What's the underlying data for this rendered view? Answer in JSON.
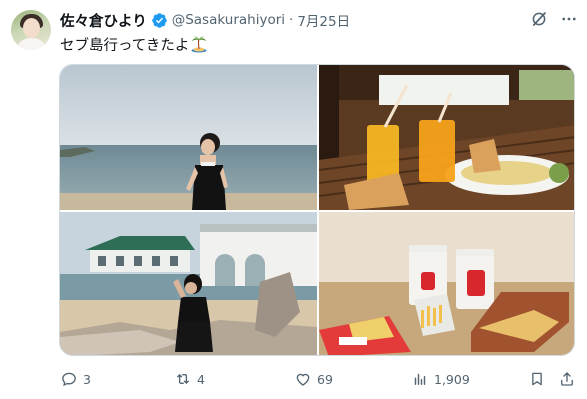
{
  "tweet": {
    "author_name": "佐々倉ひより",
    "handle": "@Sasakurahiyori",
    "separator": "·",
    "date": "7月25日",
    "text": "セブ島行ってきたよ",
    "emoji_icon": "palm-tree-island-icon"
  },
  "media": {
    "photos": [
      {
        "name": "beach-portrait",
        "icon": "photo-icon"
      },
      {
        "name": "breakfast-juice",
        "icon": "photo-icon"
      },
      {
        "name": "resort-driftwood",
        "icon": "photo-icon"
      },
      {
        "name": "fast-food-fries",
        "icon": "photo-icon"
      }
    ]
  },
  "actions": {
    "reply_count": "3",
    "retweet_count": "4",
    "like_count": "69",
    "view_count": "1,909"
  },
  "colors": {
    "verified": "#1d9bf0",
    "muted_text": "#536471",
    "text": "#0f1419",
    "border": "#cfd9de"
  }
}
